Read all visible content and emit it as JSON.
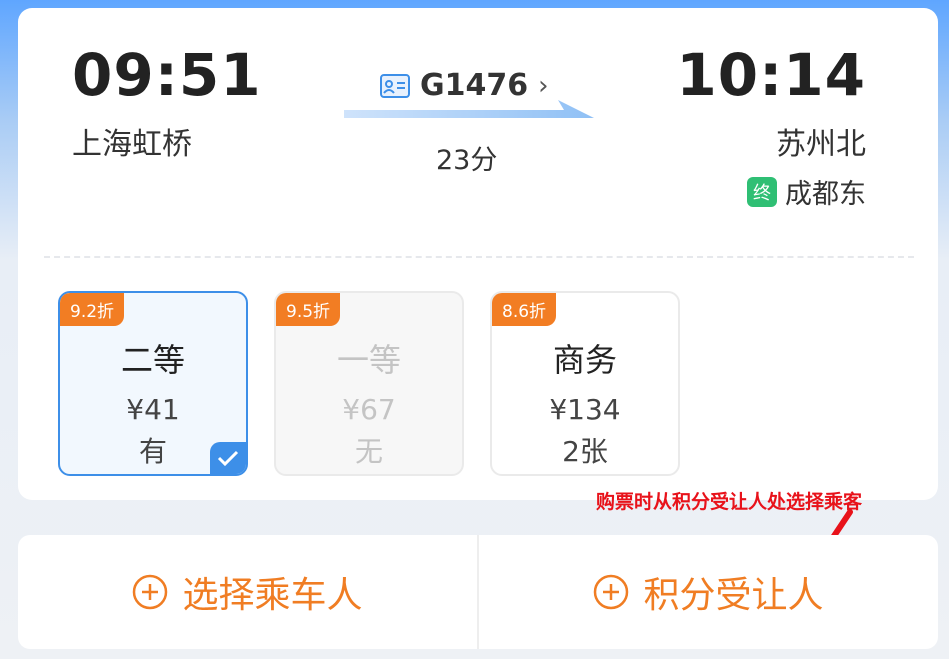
{
  "train": {
    "departure_time": "09:51",
    "departure_station": "上海虹桥",
    "arrival_time": "10:14",
    "arrival_station": "苏州北",
    "train_number": "G1476",
    "duration": "23分",
    "terminal_badge": "终",
    "terminal_station": "成都东"
  },
  "seats": [
    {
      "discount": "9.2折",
      "name": "二等",
      "price": "¥41",
      "availability": "有",
      "selected": true,
      "available": true
    },
    {
      "discount": "9.5折",
      "name": "一等",
      "price": "¥67",
      "availability": "无",
      "selected": false,
      "available": false
    },
    {
      "discount": "8.6折",
      "name": "商务",
      "price": "¥134",
      "availability": "2张",
      "selected": false,
      "available": true
    }
  ],
  "annotation": "购票时从积分受让人处选择乘客",
  "actions": {
    "select_passenger": "选择乘车人",
    "points_transferee": "积分受让人"
  },
  "colors": {
    "accent_orange": "#f07d23",
    "selected_blue": "#3d8fe8",
    "terminal_green": "#2fbf74",
    "annotation_red": "#e8121a"
  }
}
